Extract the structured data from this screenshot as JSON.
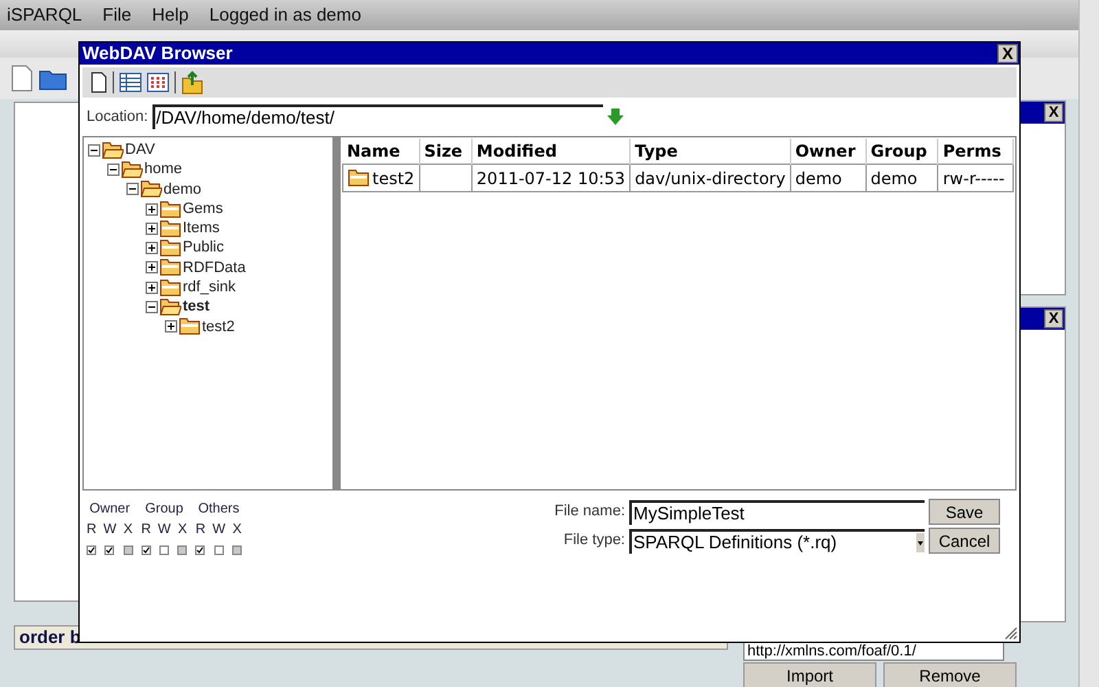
{
  "menu_bar": {
    "items": [
      "iSPARQL",
      "File",
      "Help"
    ],
    "status": "Logged in as demo"
  },
  "query_bar": {
    "label": "order b"
  },
  "namespace": {
    "value": "http://xmlns.com/foaf/0.1/"
  },
  "namespace_buttons": [
    "Import",
    "Remove"
  ],
  "side_panels": [
    {
      "close": "X"
    },
    {
      "close": "X"
    }
  ],
  "dialog": {
    "title": "WebDAV Browser",
    "close": "X",
    "location": {
      "label": "Location:",
      "value": "/DAV/home/demo/test/"
    },
    "tree": [
      {
        "label": "DAV",
        "expanded": true,
        "selected": false,
        "children": [
          {
            "label": "home",
            "expanded": true,
            "selected": false,
            "children": [
              {
                "label": "demo",
                "expanded": true,
                "selected": false,
                "children": [
                  {
                    "label": "Gems",
                    "expanded": false,
                    "selected": false
                  },
                  {
                    "label": "Items",
                    "expanded": false,
                    "selected": false
                  },
                  {
                    "label": "Public",
                    "expanded": false,
                    "selected": false
                  },
                  {
                    "label": "RDFData",
                    "expanded": false,
                    "selected": false
                  },
                  {
                    "label": "rdf_sink",
                    "expanded": false,
                    "selected": false
                  },
                  {
                    "label": "test",
                    "expanded": true,
                    "selected": true,
                    "children": [
                      {
                        "label": "test2",
                        "expanded": false,
                        "selected": false
                      }
                    ]
                  }
                ]
              }
            ]
          }
        ]
      }
    ],
    "table": {
      "columns": [
        "Name",
        "Size",
        "Modified",
        "Type",
        "Owner",
        "Group",
        "Perms"
      ],
      "rows": [
        [
          "test2",
          "",
          "2011-07-12 10:53",
          "dav/unix-directory",
          "demo",
          "demo",
          "rw-r-----"
        ]
      ]
    },
    "permissions": {
      "groups": [
        {
          "label": "Owner",
          "bits": [
            {
              "label": "R",
              "checked": true,
              "disabled": false
            },
            {
              "label": "W",
              "checked": true,
              "disabled": false
            },
            {
              "label": "X",
              "checked": false,
              "disabled": true
            }
          ]
        },
        {
          "label": "Group",
          "bits": [
            {
              "label": "R",
              "checked": true,
              "disabled": false
            },
            {
              "label": "W",
              "checked": false,
              "disabled": false
            },
            {
              "label": "X",
              "checked": false,
              "disabled": true
            }
          ]
        },
        {
          "label": "Others",
          "bits": [
            {
              "label": "R",
              "checked": true,
              "disabled": false
            },
            {
              "label": "W",
              "checked": false,
              "disabled": false
            },
            {
              "label": "X",
              "checked": false,
              "disabled": true
            }
          ]
        }
      ]
    },
    "file_name": {
      "label": "File name:",
      "value": "MySimpleTest"
    },
    "file_type": {
      "label": "File type:",
      "value": "SPARQL Definitions (*.rq)"
    },
    "buttons": [
      "Save",
      "Cancel"
    ]
  }
}
